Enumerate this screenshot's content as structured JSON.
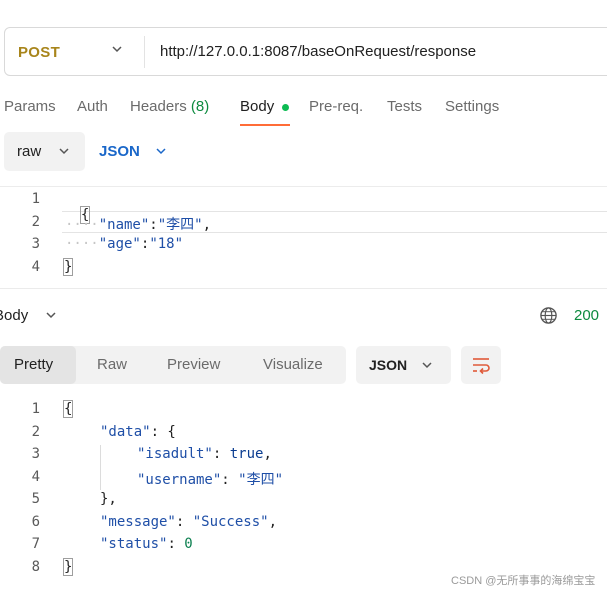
{
  "request": {
    "method": "POST",
    "url": "http://127.0.0.1:8087/baseOnRequest/response"
  },
  "tabs": {
    "params": "Params",
    "auth": "Auth",
    "headers": "Headers",
    "headers_count": "(8)",
    "body": "Body",
    "prereq": "Pre-req.",
    "tests": "Tests",
    "settings": "Settings"
  },
  "body_mode": {
    "type": "raw",
    "format": "JSON"
  },
  "request_body": {
    "line_numbers": [
      "1",
      "2",
      "3",
      "4"
    ],
    "open_brace": "{",
    "name_key": "\"name\"",
    "name_value": "\"李四\"",
    "age_key": "\"age\"",
    "age_value": "\"18\"",
    "close_brace": "}"
  },
  "response": {
    "section_label": "Body",
    "status_code": "200",
    "tabs": {
      "pretty": "Pretty",
      "raw": "Raw",
      "preview": "Preview",
      "visualize": "Visualize"
    },
    "format": "JSON",
    "line_numbers": [
      "1",
      "2",
      "3",
      "4",
      "5",
      "6",
      "7",
      "8"
    ],
    "data_key": "\"data\"",
    "isadult_key": "\"isadult\"",
    "isadult_value": "true",
    "username_key": "\"username\"",
    "username_value": "\"李四\"",
    "message_key": "\"message\"",
    "message_value": "\"Success\"",
    "status_key": "\"status\"",
    "status_value": "0"
  },
  "watermark": "CSDN @无所事事的海绵宝宝",
  "colors": {
    "method": "#a8851b",
    "accent_underline": "#ff6c37",
    "json_link": "#1a67c9",
    "success": "#0d8a3f"
  },
  "icons": [
    "chevron-down-icon",
    "globe-icon",
    "wrap-lines-icon"
  ]
}
